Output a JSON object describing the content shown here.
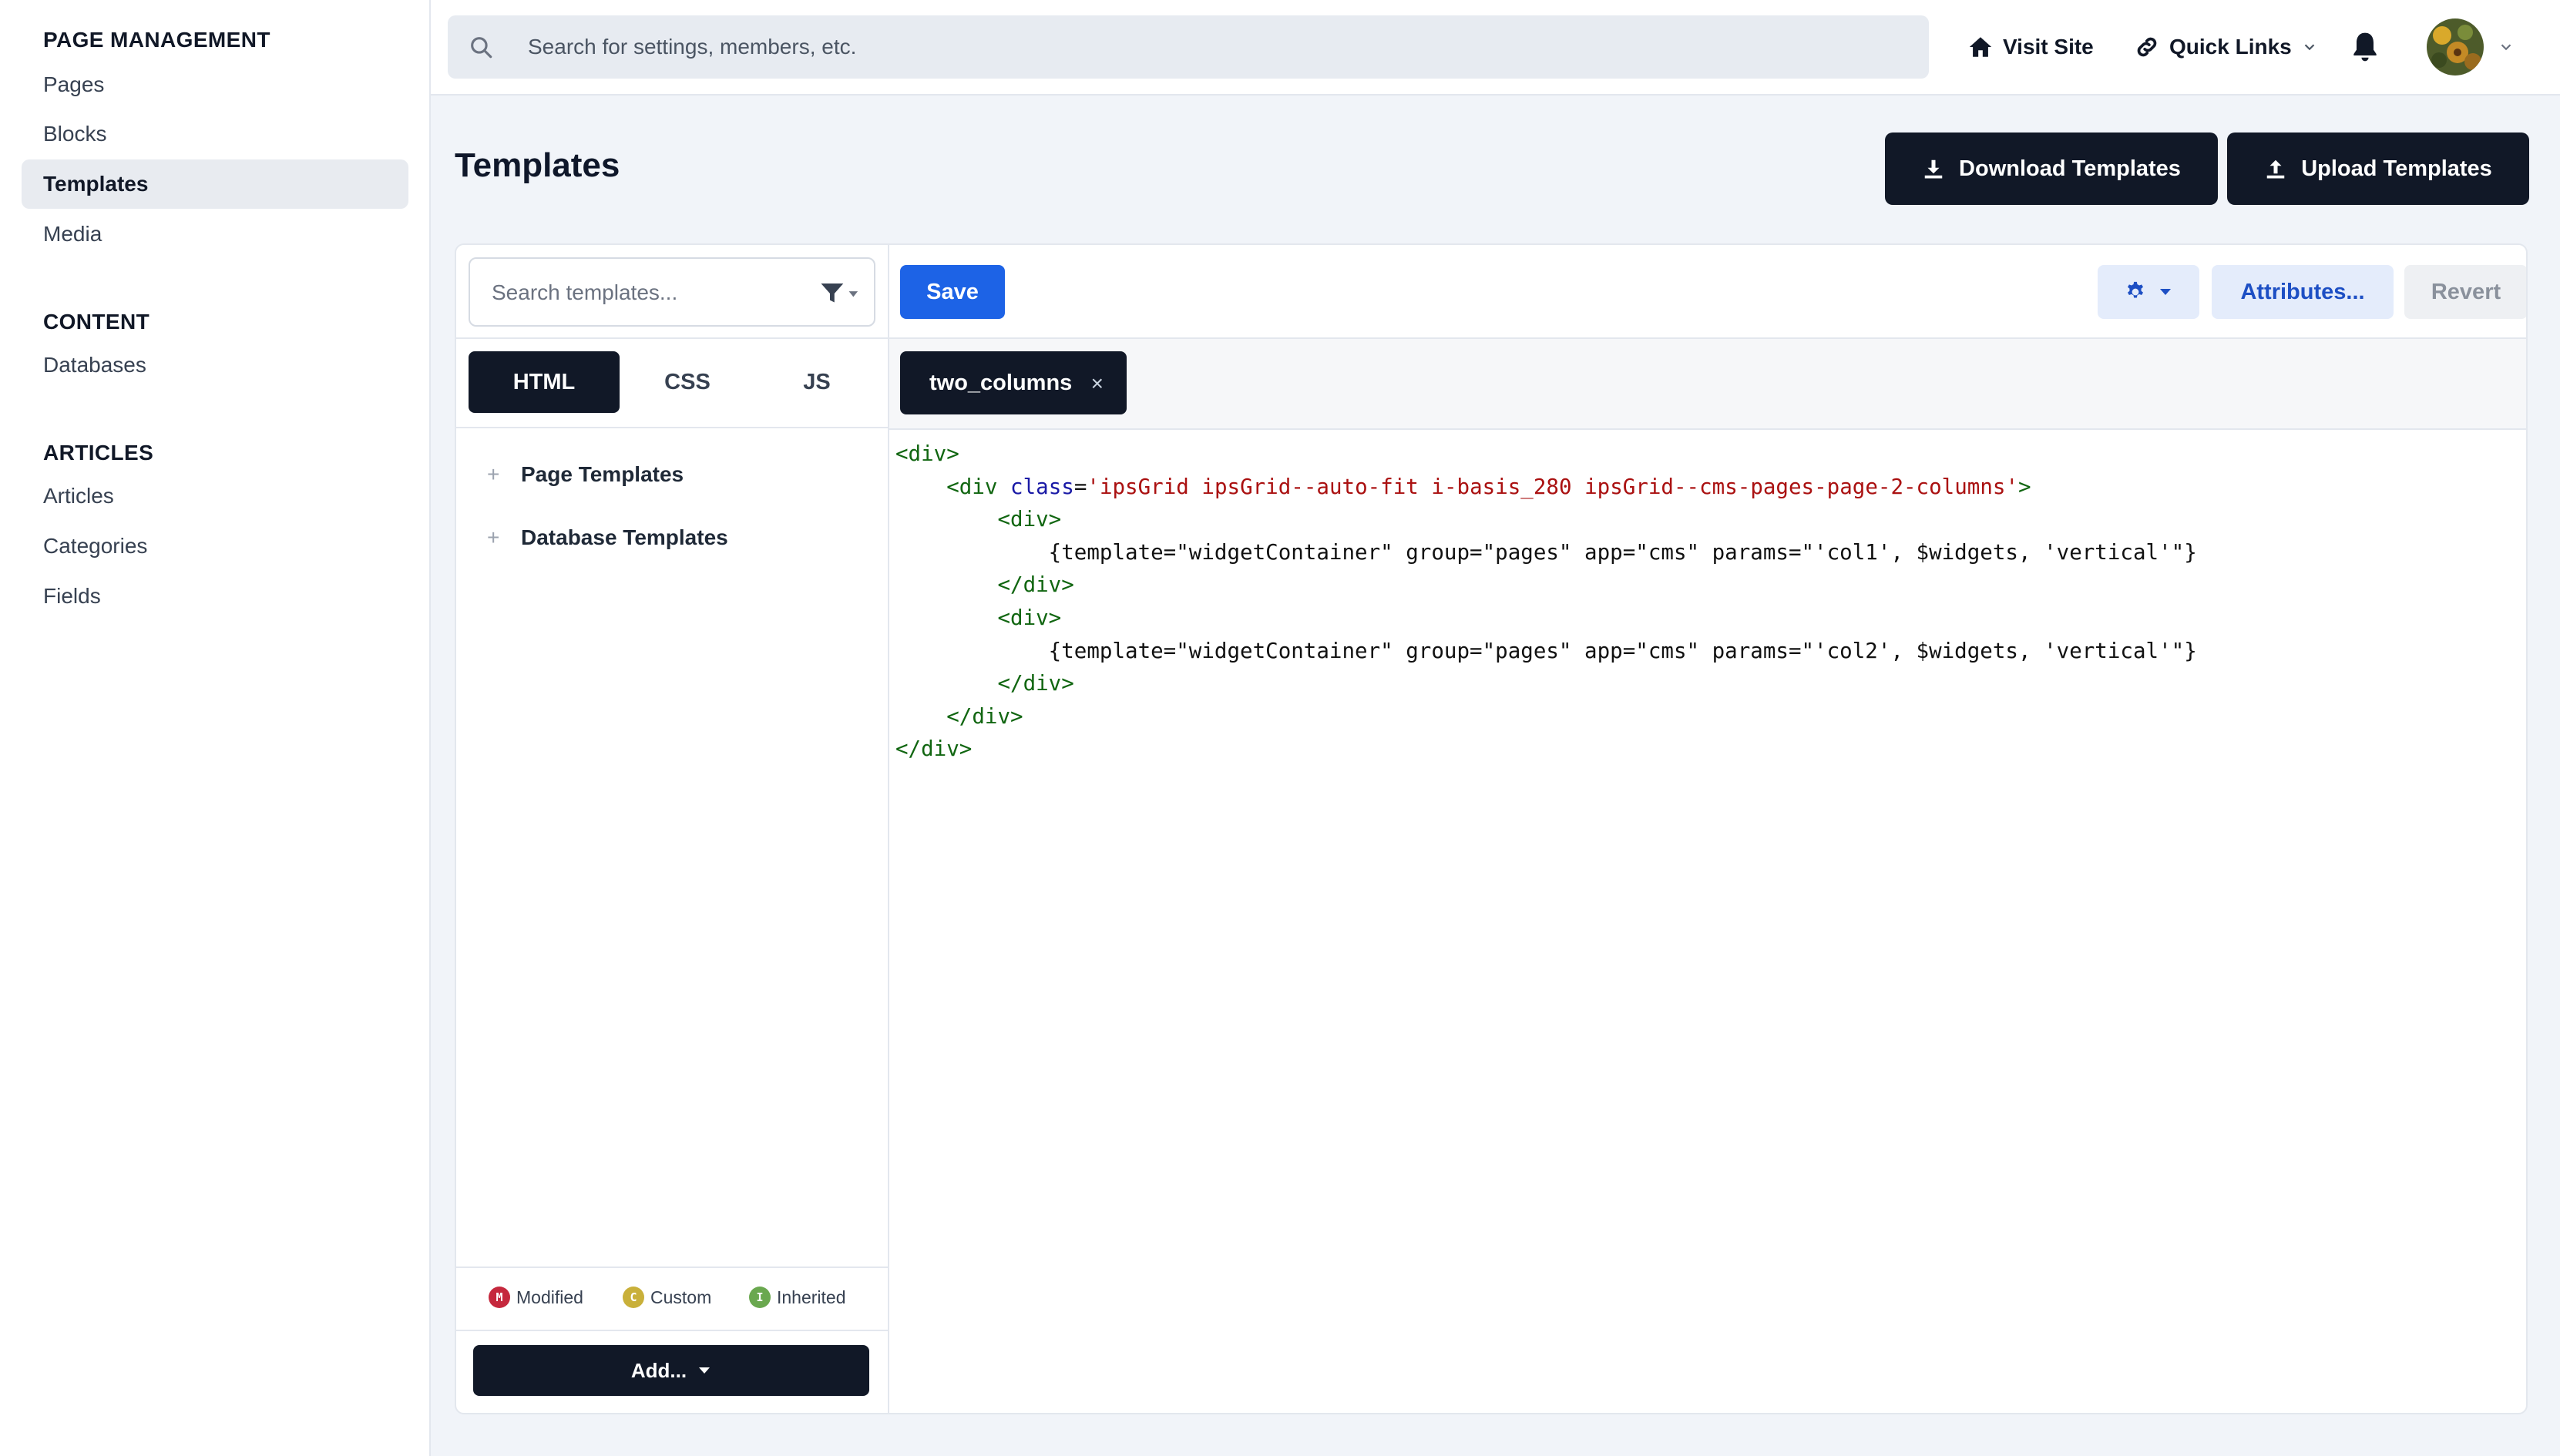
{
  "sidebar": {
    "sections": [
      {
        "heading": "PAGE MANAGEMENT",
        "items": [
          "Pages",
          "Blocks",
          "Templates",
          "Media"
        ]
      },
      {
        "heading": "CONTENT",
        "items": [
          "Databases"
        ]
      },
      {
        "heading": "ARTICLES",
        "items": [
          "Articles",
          "Categories",
          "Fields"
        ]
      }
    ],
    "active_item": "Templates"
  },
  "header": {
    "search_placeholder": "Search for settings, members, etc.",
    "visit_site": "Visit Site",
    "quick_links": "Quick Links"
  },
  "page": {
    "title": "Templates",
    "download_label": "Download Templates",
    "upload_label": "Upload Templates"
  },
  "editor": {
    "search_placeholder": "Search templates...",
    "tabs": [
      "HTML",
      "CSS",
      "JS"
    ],
    "active_tab": "HTML",
    "tree": [
      "Page Templates",
      "Database Templates"
    ],
    "legend": [
      {
        "letter": "M",
        "label": "Modified",
        "color": "#c5283d"
      },
      {
        "letter": "C",
        "label": "Custom",
        "color": "#c9b03a"
      },
      {
        "letter": "I",
        "label": "Inherited",
        "color": "#6aa84f"
      }
    ],
    "add_label": "Add...",
    "save_label": "Save",
    "attributes_label": "Attributes...",
    "revert_label": "Revert",
    "open_file": "two_columns",
    "code_lines": [
      "<div>",
      "    <div class='ipsGrid ipsGrid--auto-fit i-basis_280 ipsGrid--cms-pages-page-2-columns'>",
      "        <div>",
      "            {template=\"widgetContainer\" group=\"pages\" app=\"cms\" params=\"'col1', $widgets, 'vertical'\"}",
      "        </div>",
      "        <div>",
      "            {template=\"widgetContainer\" group=\"pages\" app=\"cms\" params=\"'col2', $widgets, 'vertical'\"}",
      "        </div>",
      "    </div>",
      "</div>"
    ]
  },
  "colors": {
    "accent": "#1d63e6",
    "dark": "#111827",
    "background": "#f1f4f9"
  }
}
